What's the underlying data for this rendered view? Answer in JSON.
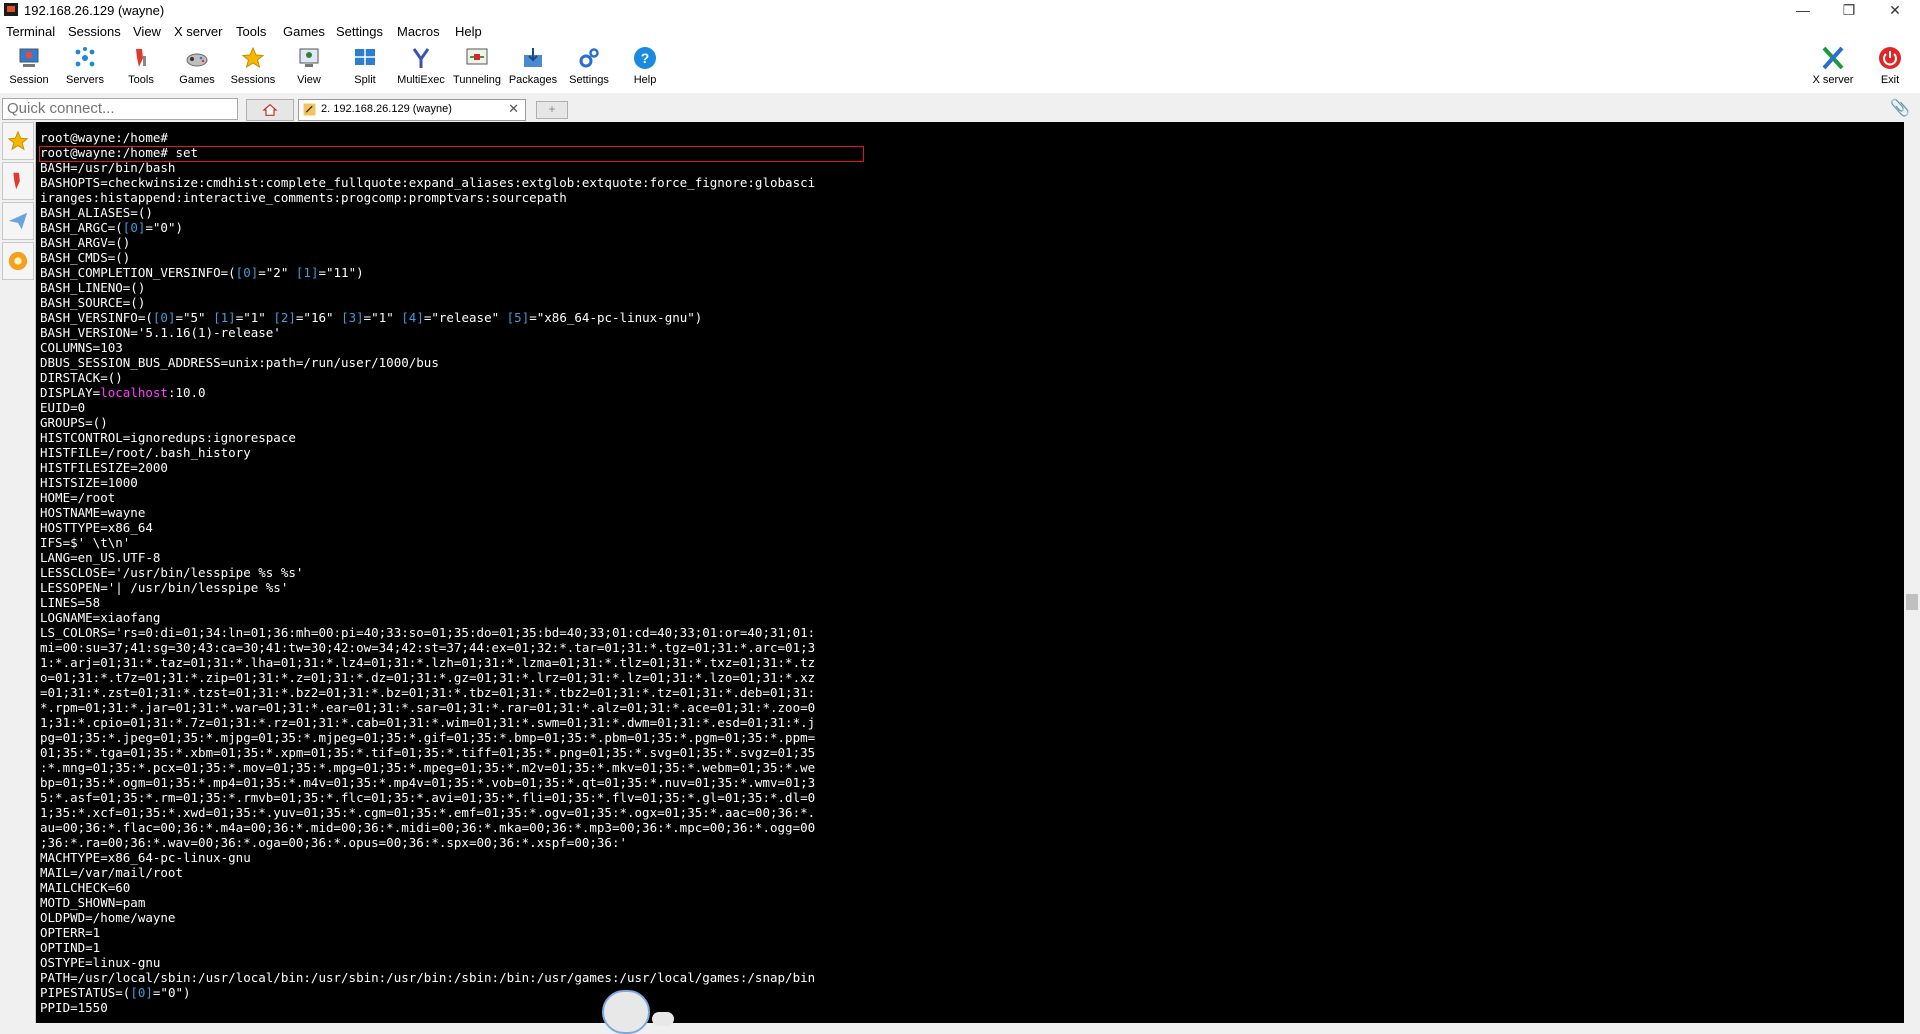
{
  "window": {
    "title": "192.168.26.129 (wayne)",
    "minimize": "—",
    "restore": "❐",
    "close": "✕"
  },
  "menu": [
    "Terminal",
    "Sessions",
    "View",
    "X server",
    "Tools",
    "Games",
    "Settings",
    "Macros",
    "Help"
  ],
  "toolbar": {
    "session": "Session",
    "servers": "Servers",
    "tools": "Tools",
    "games": "Games",
    "sessions": "Sessions",
    "view": "View",
    "split": "Split",
    "multiexec": "MultiExec",
    "tunneling": "Tunneling",
    "packages": "Packages",
    "settings": "Settings",
    "help": "Help",
    "xserver": "X server",
    "exit": "Exit"
  },
  "quick_connect": {
    "placeholder": "Quick connect..."
  },
  "tab": {
    "label": "2. 192.168.26.129 (wayne)",
    "close": "✕",
    "new_tab": "+"
  },
  "terminal": {
    "lines": [
      "root@wayne:/home#",
      "root@wayne:/home# set",
      "BASH=/usr/bin/bash",
      "BASHOPTS=checkwinsize:cmdhist:complete_fullquote:expand_aliases:extglob:extquote:force_fignore:globasci",
      "iranges:histappend:interactive_comments:progcomp:promptvars:sourcepath",
      "BASH_ALIASES=()",
      "BASH_ARGC=([0]=\"0\")",
      "BASH_ARGV=()",
      "BASH_CMDS=()",
      "BASH_COMPLETION_VERSINFO=([0]=\"2\" [1]=\"11\")",
      "BASH_LINENO=()",
      "BASH_SOURCE=()",
      "BASH_VERSINFO=([0]=\"5\" [1]=\"1\" [2]=\"16\" [3]=\"1\" [4]=\"release\" [5]=\"x86_64-pc-linux-gnu\")",
      "BASH_VERSION='5.1.16(1)-release'",
      "COLUMNS=103",
      "DBUS_SESSION_BUS_ADDRESS=unix:path=/run/user/1000/bus",
      "DIRSTACK=()",
      "DISPLAY=localhost:10.0",
      "EUID=0",
      "GROUPS=()",
      "HISTCONTROL=ignoredups:ignorespace",
      "HISTFILE=/root/.bash_history",
      "HISTFILESIZE=2000",
      "HISTSIZE=1000",
      "HOME=/root",
      "HOSTNAME=wayne",
      "HOSTTYPE=x86_64",
      "IFS=$' \\t\\n'",
      "LANG=en_US.UTF-8",
      "LESSCLOSE='/usr/bin/lesspipe %s %s'",
      "LESSOPEN='| /usr/bin/lesspipe %s'",
      "LINES=58",
      "LOGNAME=xiaofang",
      "LS_COLORS='rs=0:di=01;34:ln=01;36:mh=00:pi=40;33:so=01;35:do=01;35:bd=40;33;01:cd=40;33;01:or=40;31;01:",
      "mi=00:su=37;41:sg=30;43:ca=30;41:tw=30;42:ow=34;42:st=37;44:ex=01;32:*.tar=01;31:*.tgz=01;31:*.arc=01;3",
      "1:*.arj=01;31:*.taz=01;31:*.lha=01;31:*.lz4=01;31:*.lzh=01;31:*.lzma=01;31:*.tlz=01;31:*.txz=01;31:*.tz",
      "o=01;31:*.t7z=01;31:*.zip=01;31:*.z=01;31:*.dz=01;31:*.gz=01;31:*.lrz=01;31:*.lz=01;31:*.lzo=01;31:*.xz",
      "=01;31:*.zst=01;31:*.tzst=01;31:*.bz2=01;31:*.bz=01;31:*.tbz=01;31:*.tbz2=01;31:*.tz=01;31:*.deb=01;31:",
      "*.rpm=01;31:*.jar=01;31:*.war=01;31:*.ear=01;31:*.sar=01;31:*.rar=01;31:*.alz=01;31:*.ace=01;31:*.zoo=0",
      "1;31:*.cpio=01;31:*.7z=01;31:*.rz=01;31:*.cab=01;31:*.wim=01;31:*.swm=01;31:*.dwm=01;31:*.esd=01;31:*.j",
      "pg=01;35:*.jpeg=01;35:*.mjpg=01;35:*.mjpeg=01;35:*.gif=01;35:*.bmp=01;35:*.pbm=01;35:*.pgm=01;35:*.ppm=",
      "01;35:*.tga=01;35:*.xbm=01;35:*.xpm=01;35:*.tif=01;35:*.tiff=01;35:*.png=01;35:*.svg=01;35:*.svgz=01;35",
      ":*.mng=01;35:*.pcx=01;35:*.mov=01;35:*.mpg=01;35:*.mpeg=01;35:*.m2v=01;35:*.mkv=01;35:*.webm=01;35:*.we",
      "bp=01;35:*.ogm=01;35:*.mp4=01;35:*.m4v=01;35:*.mp4v=01;35:*.vob=01;35:*.qt=01;35:*.nuv=01;35:*.wmv=01;3",
      "5:*.asf=01;35:*.rm=01;35:*.rmvb=01;35:*.flc=01;35:*.avi=01;35:*.fli=01;35:*.flv=01;35:*.gl=01;35:*.dl=0",
      "1;35:*.xcf=01;35:*.xwd=01;35:*.yuv=01;35:*.cgm=01;35:*.emf=01;35:*.ogv=01;35:*.ogx=01;35:*.aac=00;36:*.",
      "au=00;36:*.flac=00;36:*.m4a=00;36:*.mid=00;36:*.midi=00;36:*.mka=00;36:*.mp3=00;36:*.mpc=00;36:*.ogg=00",
      ";36:*.ra=00;36:*.wav=00;36:*.oga=00;36:*.opus=00;36:*.spx=00;36:*.xspf=00;36:'",
      "MACHTYPE=x86_64-pc-linux-gnu",
      "MAIL=/var/mail/root",
      "MAILCHECK=60",
      "MOTD_SHOWN=pam",
      "OLDPWD=/home/wayne",
      "OPTERR=1",
      "OPTIND=1",
      "OSTYPE=linux-gnu",
      "PATH=/usr/local/sbin:/usr/local/bin:/usr/sbin:/usr/bin:/sbin:/bin:/usr/games:/usr/local/games:/snap/bin",
      "PIPESTATUS=([0]=\"0\")",
      "PPID=1550"
    ]
  },
  "colors": {
    "terminal_bg": "#000000",
    "terminal_fg": "#ffffff",
    "index": "#3e9bd6",
    "hostname": "#ff3cff",
    "highlight_box": "#e01818"
  },
  "icons": [
    "session-icon",
    "servers-icon",
    "tools-icon",
    "games-icon",
    "sessions-icon",
    "view-icon",
    "split-icon",
    "multiexec-icon",
    "tunneling-icon",
    "packages-icon",
    "settings-icon",
    "help-icon",
    "xserver-icon",
    "exit-icon",
    "home-icon",
    "paperclip-icon",
    "star-icon",
    "tools-side-icon",
    "send-icon",
    "macros-icon"
  ]
}
